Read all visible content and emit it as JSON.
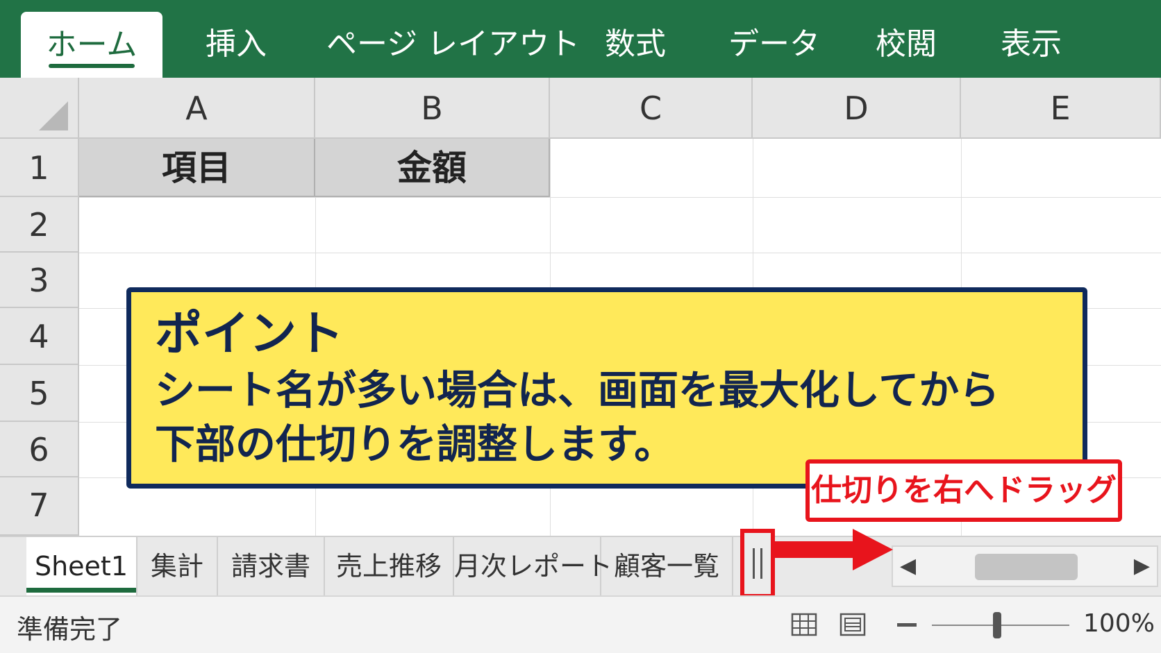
{
  "ribbon": {
    "tabs": [
      {
        "label": "ホーム",
        "active": true
      },
      {
        "label": "挿入"
      },
      {
        "label": "ページ レイアウト"
      },
      {
        "label": "数式"
      },
      {
        "label": "データ"
      },
      {
        "label": "校閲"
      },
      {
        "label": "表示"
      }
    ],
    "color": "#217346"
  },
  "grid": {
    "columns": [
      "A",
      "B",
      "C",
      "D",
      "E"
    ],
    "rows": [
      "1",
      "2",
      "3",
      "4",
      "5",
      "6",
      "7"
    ],
    "cells": {
      "A1": "項目",
      "B1": "金額"
    }
  },
  "callout": {
    "title": "ポイント",
    "line1": "シート名が多い場合は、画面を最大化してから",
    "line2": "下部の仕切りを調整します。"
  },
  "annotation": {
    "label": "仕切りを右へドラッグ",
    "color": "#e8141c"
  },
  "sheet_tabs": [
    {
      "label": "Sheet1",
      "active": true
    },
    {
      "label": "集計"
    },
    {
      "label": "請求書"
    },
    {
      "label": "売上推移"
    },
    {
      "label": "月次レポート"
    },
    {
      "label": "顧客一覧"
    }
  ],
  "scroll": {
    "left_glyph": "◀",
    "right_glyph": "▶"
  },
  "status": {
    "ready": "準備完了",
    "zoom": "100%"
  }
}
